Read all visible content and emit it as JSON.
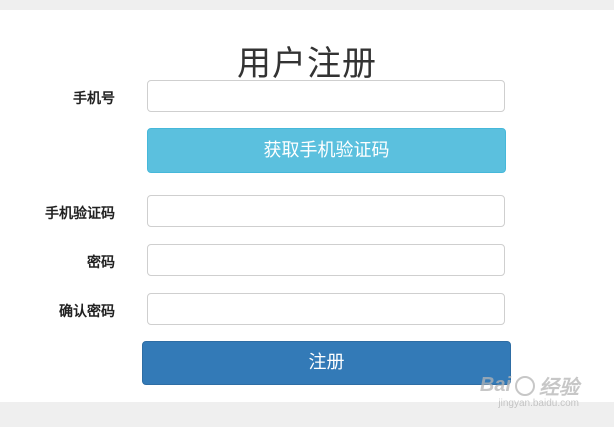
{
  "form": {
    "title": "用户注册",
    "phone_label": "手机号",
    "phone_value": "",
    "get_code_label": "获取手机验证码",
    "code_label": "手机验证码",
    "code_value": "",
    "password_label": "密码",
    "password_value": "",
    "confirm_label": "确认密码",
    "confirm_value": "",
    "submit_label": "注册"
  },
  "watermark": {
    "brand": "Bai",
    "brand_suffix": "经验",
    "url": "jingyan.baidu.com"
  }
}
